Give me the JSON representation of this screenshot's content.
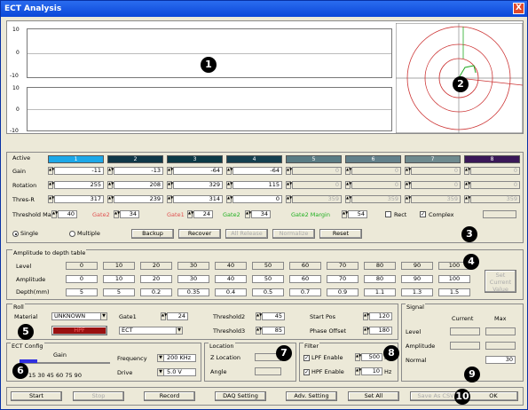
{
  "window": {
    "title": "ECT Analysis",
    "close": "X"
  },
  "plots": {
    "y_top": [
      "10",
      "0",
      "-10"
    ],
    "y_bottom": [
      "10",
      "0",
      "-10"
    ]
  },
  "badges": [
    "1",
    "2",
    "3",
    "4",
    "5",
    "6",
    "7",
    "8",
    "9",
    "10"
  ],
  "channels": {
    "active_label": "Active",
    "tabs": [
      "1",
      "2",
      "3",
      "4",
      "5",
      "6",
      "7",
      "8"
    ],
    "rows": [
      {
        "label": "Gain",
        "values": [
          "-11",
          "-13",
          "-64",
          "-64",
          "0",
          "0",
          "0",
          "0"
        ]
      },
      {
        "label": "Rotation",
        "values": [
          "255",
          "208",
          "329",
          "115",
          "0",
          "0",
          "0",
          "0"
        ]
      },
      {
        "label": "Thres-R",
        "values": [
          "317",
          "239",
          "314",
          "0",
          "359",
          "359",
          "359",
          "359"
        ]
      }
    ],
    "threshold_margin_label": "Threshold Margin",
    "threshold_margin": "40",
    "gate2_label": "Gate2",
    "gate2": "34",
    "gate1_label": "Gate1",
    "gate1": "24",
    "gate2b_label": "Gate2",
    "gate2b": "34",
    "gate2_margin_label": "Gate2 Margin",
    "gate2_margin": "54",
    "rect_label": "Rect",
    "complex_label": "Complex",
    "single_label": "Single",
    "multiple_label": "Multiple",
    "buttons": [
      "Backup",
      "Recover",
      "All Release",
      "Normalize",
      "Reset"
    ]
  },
  "amplitude": {
    "title": "Amplitude to depth table",
    "level_label": "Level",
    "amplitude_label": "Amplitude",
    "depth_label": "Depth(mm)",
    "levels": [
      "0",
      "10",
      "20",
      "30",
      "40",
      "50",
      "60",
      "70",
      "80",
      "90",
      "100"
    ],
    "amplitudes": [
      "0",
      "10",
      "20",
      "30",
      "40",
      "50",
      "60",
      "70",
      "80",
      "90",
      "100"
    ],
    "depths": [
      "5",
      "5",
      "0.2",
      "0.35",
      "0.4",
      "0.5",
      "0.7",
      "0.9",
      "1.1",
      "1.3",
      "1.5"
    ],
    "set_button": "Set Current Value"
  },
  "roll": {
    "title": "Roll",
    "material_label": "Material",
    "material": "UNKNOWN",
    "hpf_label": "HPF",
    "gate1_label": "Gate1",
    "gate1": "24",
    "mode": "ECT",
    "threshold2_label": "Threshold2",
    "threshold2": "45",
    "threshold3_label": "Threshold3",
    "threshold3": "85",
    "start_pos_label": "Start Pos",
    "start_pos": "120",
    "phase_offset_label": "Phase Offset",
    "phase_offset": "180"
  },
  "signal": {
    "title": "Signal",
    "current_label": "Current",
    "max_label": "Max",
    "level_label": "Level",
    "amplitude_label": "Amplitude",
    "normal_label": "Normal",
    "normal": "30"
  },
  "ect_config": {
    "title": "ECT Config",
    "gain_label": "Gain",
    "scale": "15 30 45 60 75 90",
    "frequency_label": "Frequency",
    "frequency": "200 KHz",
    "drive_label": "Drive",
    "drive": "5.0 V"
  },
  "location": {
    "title": "Location",
    "z_label": "Z Location",
    "angle_label": "Angle"
  },
  "filter": {
    "title": "Filter",
    "lpf_label": "LPF Enable",
    "lpf": "500",
    "hpf_label": "HPF Enable",
    "hpf": "10",
    "unit": "Hz"
  },
  "bottom_buttons": [
    "Start",
    "Stop",
    "Record",
    "DAQ Setting",
    "Adv. Setting",
    "Set All",
    "Save As CSV",
    "OK"
  ]
}
